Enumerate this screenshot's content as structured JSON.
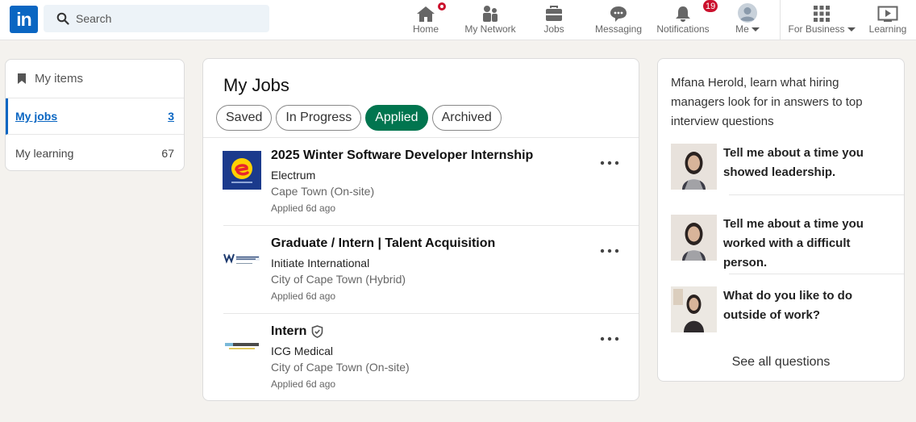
{
  "nav": {
    "logo_text": "in",
    "search_placeholder": "Search",
    "items": [
      {
        "label": "Home"
      },
      {
        "label": "My Network"
      },
      {
        "label": "Jobs"
      },
      {
        "label": "Messaging"
      },
      {
        "label": "Notifications",
        "badge": "19"
      },
      {
        "label": "Me"
      },
      {
        "label": "For Business"
      },
      {
        "label": "Learning"
      }
    ]
  },
  "left": {
    "header": "My items",
    "rows": [
      {
        "label": "My jobs",
        "count": "3"
      },
      {
        "label": "My learning",
        "count": "67"
      }
    ]
  },
  "main": {
    "title": "My Jobs",
    "filters": [
      "Saved",
      "In Progress",
      "Applied",
      "Archived"
    ],
    "active_filter": "Applied",
    "jobs": [
      {
        "title": "2025 Winter Software Developer Internship",
        "company": "Electrum",
        "location": "Cape Town (On-site)",
        "applied": "Applied 6d ago",
        "logo": "electrum-logo"
      },
      {
        "title": "Graduate / Intern | Talent Acquisition",
        "company": "Initiate International",
        "location": "City of Cape Town (Hybrid)",
        "applied": "Applied 6d ago",
        "logo": "initiate-logo"
      },
      {
        "title": "Intern",
        "company": "ICG Medical",
        "location": "City of Cape Town (On-site)",
        "applied": "Applied 6d ago",
        "logo": "icg-medical-logo",
        "verified": true
      }
    ]
  },
  "right": {
    "intro": "Mfana Herold, learn what hiring managers look for in answers to top interview questions",
    "questions": [
      "Tell me about a time you showed leadership.",
      "Tell me about a time you worked with a difficult person.",
      "What do you like to do outside of work?"
    ],
    "see_all": "See all questions"
  },
  "colors": {
    "brand": "#0a66c2",
    "applied_green": "#01754f",
    "badge_red": "#cb112d"
  }
}
